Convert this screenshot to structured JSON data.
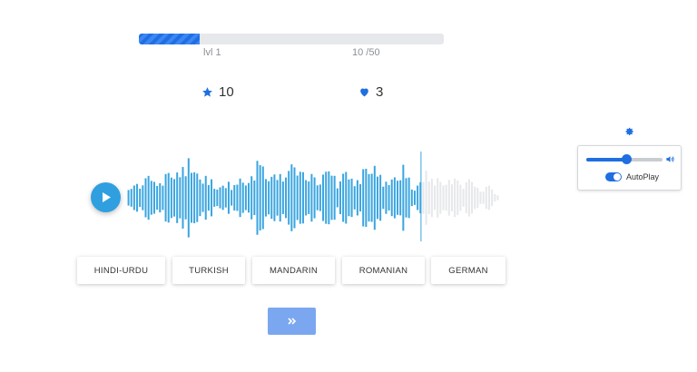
{
  "progress": {
    "value": 0.2,
    "level_label": "lvl 1",
    "count_label": "10 /50",
    "color": "#1e6fe6"
  },
  "stats": {
    "stars": "10",
    "hearts": "3",
    "star_icon": "star-icon",
    "heart_icon": "heart-icon"
  },
  "player": {
    "play_icon": "play-icon",
    "played_fraction": 0.79,
    "played_color": "#3aa5e0",
    "unplayed_color": "#e6e8ea",
    "playhead_color": "#3aa5e0"
  },
  "options": [
    "HINDI-URDU",
    "TURKISH",
    "MANDARIN",
    "ROMANIAN",
    "GERMAN"
  ],
  "next_button": {
    "icon": "double-chevron-right-icon",
    "color": "#7ba7f0"
  },
  "settings": {
    "gear_icon": "gear-icon",
    "volume": 0.52,
    "autoplay_label": "AutoPlay",
    "autoplay_on": true,
    "accent": "#1f6fe0"
  }
}
